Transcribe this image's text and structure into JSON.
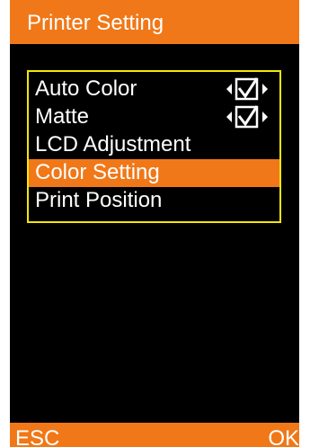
{
  "screen": {
    "title": "Printer Setting",
    "colors": {
      "accent": "#f07818",
      "background": "#000000",
      "frame": "#f2e60a",
      "text": "#ffffff"
    }
  },
  "menu": {
    "items": [
      {
        "label": "Auto Color",
        "checked": true,
        "selected": false
      },
      {
        "label": "Matte",
        "checked": true,
        "selected": false
      },
      {
        "label": "LCD Adjustment",
        "selected": false
      },
      {
        "label": "Color Setting",
        "selected": true
      },
      {
        "label": "Print Position",
        "selected": false
      }
    ],
    "toggle_icons": [
      "arrow-left-icon",
      "checkbox-checked-icon",
      "arrow-right-icon"
    ]
  },
  "softkeys": {
    "left_label": "ESC",
    "right_label": "OK"
  }
}
